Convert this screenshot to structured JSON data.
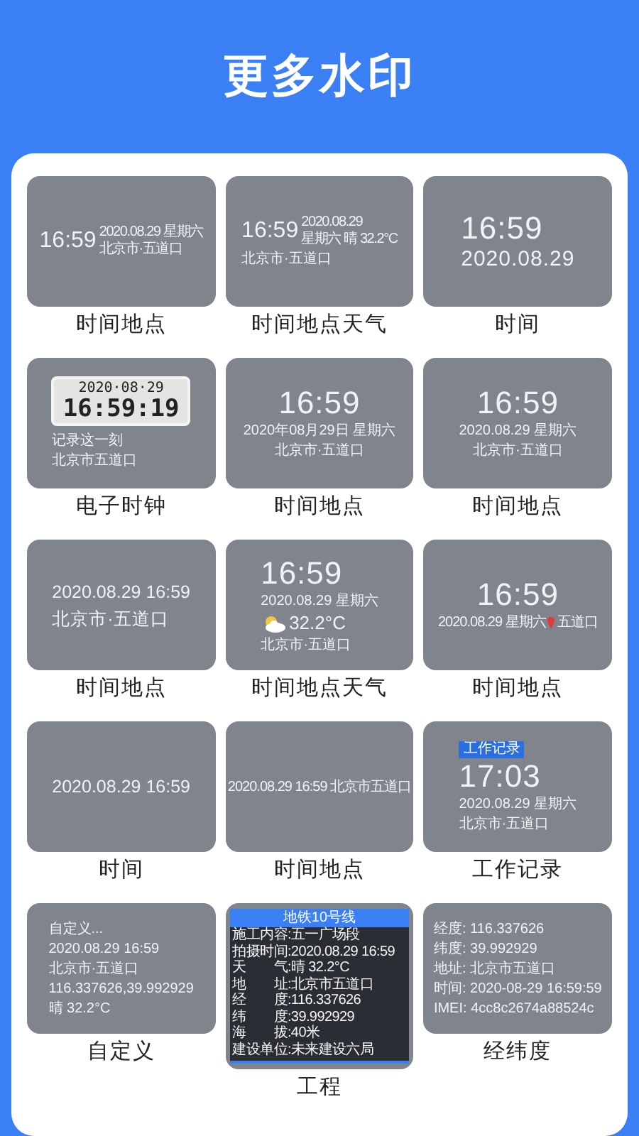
{
  "title": "更多水印",
  "tiles": [
    {
      "label": "时间地点",
      "kind": "side",
      "clock": "16:59",
      "side": [
        "2020.08.29 星期六",
        "北京市·五道口"
      ]
    },
    {
      "label": "时间地点天气",
      "kind": "side",
      "clock": "16:59",
      "side": [
        "2020.08.29",
        "星期六 晴 32.2°C"
      ],
      "below": [
        "北京市·五道口"
      ]
    },
    {
      "label": "时间",
      "kind": "flush",
      "lines": [
        {
          "kind": "clock",
          "text": "16:59"
        },
        {
          "kind": "large",
          "text": "2020.08.29"
        }
      ]
    },
    {
      "label": "电子时钟",
      "kind": "lcd",
      "date": "2020·08·29",
      "time": "16:59:19",
      "lines": [
        "记录这一刻",
        "北京市五道口"
      ]
    },
    {
      "label": "时间地点",
      "kind": "centered",
      "lines": [
        {
          "kind": "clock",
          "text": "16:59"
        },
        {
          "kind": "small",
          "text": "2020年08月29日 星期六"
        },
        {
          "kind": "small",
          "text": "北京市·五道口"
        }
      ]
    },
    {
      "label": "时间地点",
      "kind": "centered",
      "lines": [
        {
          "kind": "clock",
          "text": "16:59"
        },
        {
          "kind": "small",
          "text": "2020.08.29 星期六"
        },
        {
          "kind": "small",
          "text": "北京市·五道口"
        }
      ]
    },
    {
      "label": "时间地点",
      "kind": "flush",
      "lines": [
        {
          "kind": "medium",
          "text": "2020.08.29 16:59"
        },
        {
          "kind": "medium",
          "text": "北京市·五道口"
        }
      ]
    },
    {
      "label": "时间地点天气",
      "kind": "flush",
      "lines": [
        {
          "kind": "clock",
          "text": "16:59"
        },
        {
          "kind": "small",
          "text": "2020.08.29 星期六"
        },
        {
          "kind": "weather",
          "text": "32.2°C"
        },
        {
          "kind": "small",
          "text": "北京市·五道口"
        }
      ]
    },
    {
      "label": "时间地点",
      "kind": "centered",
      "lines": [
        {
          "kind": "clock",
          "text": "16:59"
        },
        {
          "kind": "pin",
          "text": "2020.08.29 星期六",
          "place": "五道口"
        }
      ]
    },
    {
      "label": "时间",
      "kind": "centered",
      "lines": [
        {
          "kind": "medium",
          "text": "2020.08.29 16:59"
        }
      ]
    },
    {
      "label": "时间地点",
      "kind": "centered",
      "lines": [
        {
          "kind": "tight",
          "text": "2020.08.29 16:59 北京市五道口"
        }
      ]
    },
    {
      "label": "工作记录",
      "kind": "flush",
      "lines": [
        {
          "kind": "tag",
          "text": "工作记录"
        },
        {
          "kind": "clock",
          "text": "17:03"
        },
        {
          "kind": "small",
          "text": "2020.08.29 星期六"
        },
        {
          "kind": "small",
          "text": "北京市·五道口"
        }
      ]
    },
    {
      "label": "自定义",
      "kind": "flush",
      "lines": [
        {
          "kind": "small",
          "text": "自定义..."
        },
        {
          "kind": "small",
          "text": "2020.08.29 16:59"
        },
        {
          "kind": "small",
          "text": "北京市·五道口"
        },
        {
          "kind": "small",
          "text": "116.337626,39.992929"
        },
        {
          "kind": "small",
          "text": "晴 32.2°C"
        }
      ]
    },
    {
      "label": "工程",
      "kind": "table",
      "heading": "地铁10号线",
      "rows": [
        "施工内容:五一广场段",
        "拍摄时间:2020.08.29 16:59",
        "天　　气:晴 32.2°C",
        "地　　址:北京市五道口",
        "经　　度:116.337626",
        "纬　　度:39.992929",
        "海　　拔:40米",
        "建设单位:未来建设六局"
      ]
    },
    {
      "label": "经纬度",
      "kind": "flush",
      "lines": [
        {
          "kind": "small",
          "text": "经度: 116.337626"
        },
        {
          "kind": "small",
          "text": "纬度: 39.992929"
        },
        {
          "kind": "small",
          "text": "地址: 北京市五道口"
        },
        {
          "kind": "small",
          "text": "时间: 2020-08-29 16:59:59"
        },
        {
          "kind": "small",
          "text": "IMEI: 4cc8c2674a88524c"
        }
      ]
    }
  ]
}
